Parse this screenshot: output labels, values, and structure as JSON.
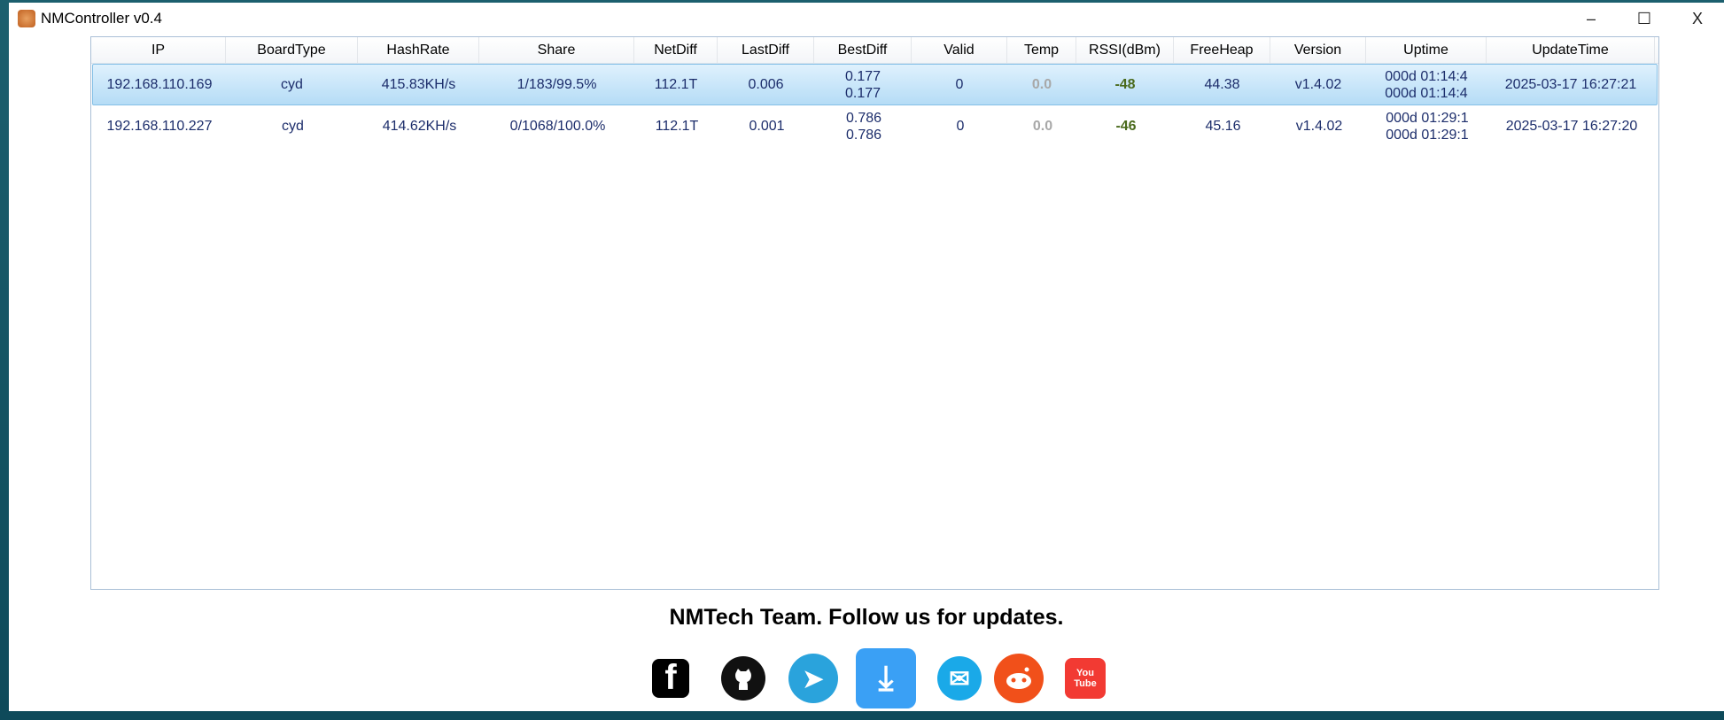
{
  "window": {
    "title": "NMController v0.4",
    "minimize": "–",
    "maximize": "☐",
    "close": "X"
  },
  "columns": [
    "IP",
    "BoardType",
    "HashRate",
    "Share",
    "NetDiff",
    "LastDiff",
    "BestDiff",
    "Valid",
    "Temp",
    "RSSI(dBm)",
    "FreeHeap",
    "Version",
    "Uptime",
    "UpdateTime"
  ],
  "rows": [
    {
      "ip": "192.168.110.169",
      "board": "cyd",
      "hashrate": "415.83KH/s",
      "share": "1/183/99.5%",
      "netdiff": "112.1T",
      "lastdiff": "0.006",
      "bestdiff1": "0.177",
      "bestdiff2": "0.177",
      "valid": "0",
      "temp": "0.0",
      "rssi": "-48",
      "freeheap": "44.38",
      "version": "v1.4.02",
      "uptime1": "000d 01:14:4",
      "uptime2": "000d 01:14:4",
      "updatetime": "2025-03-17 16:27:21"
    },
    {
      "ip": "192.168.110.227",
      "board": "cyd",
      "hashrate": "414.62KH/s",
      "share": "0/1068/100.0%",
      "netdiff": "112.1T",
      "lastdiff": "0.001",
      "bestdiff1": "0.786",
      "bestdiff2": "0.786",
      "valid": "0",
      "temp": "0.0",
      "rssi": "-46",
      "freeheap": "45.16",
      "version": "v1.4.02",
      "uptime1": "000d 01:29:1",
      "uptime2": "000d 01:29:1",
      "updatetime": "2025-03-17 16:27:20"
    }
  ],
  "footer": {
    "text": "NMTech Team. Follow us for updates.",
    "icons": {
      "facebook": "f",
      "github": "github-icon",
      "telegram": "➤",
      "download": "⤓",
      "email": "✉",
      "reddit": "reddit-icon",
      "youtube": "You Tube"
    }
  }
}
